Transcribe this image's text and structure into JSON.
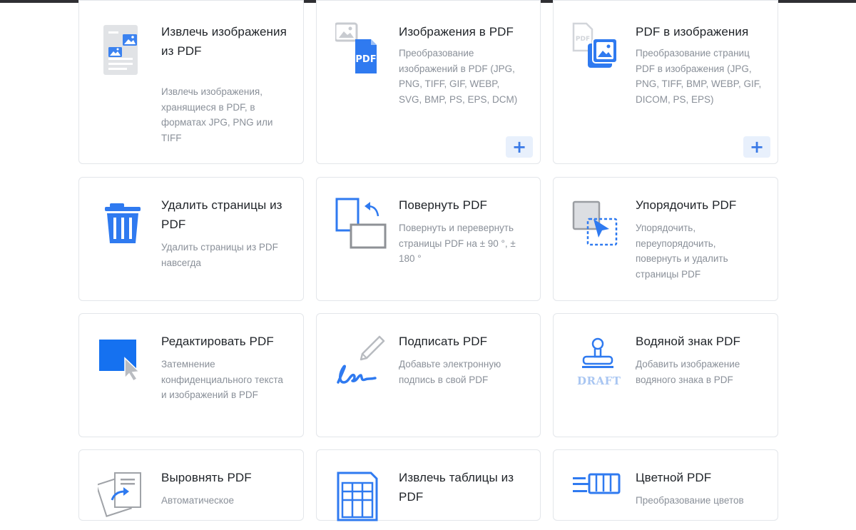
{
  "accent_color": "#2f7af0",
  "cards": [
    {
      "title": "Извлечь изображения из PDF",
      "desc": "Извлечь изображения, хранящиеся в PDF, в форматах JPG, PNG или TIFF",
      "icon": "extract-images-icon"
    },
    {
      "title": "Изображения в PDF",
      "desc": "Преобразование изображений в PDF (JPG, PNG, TIFF, GIF, WEBP, SVG, BMP, PS, EPS, DCM)",
      "icon": "image-to-pdf-icon",
      "plus": "+"
    },
    {
      "title": "PDF в изображения",
      "desc": "Преобразование страниц PDF в изображения (JPG, PNG, TIFF, BMP, WEBP, GIF, DICOM, PS, EPS)",
      "icon": "pdf-to-image-icon",
      "plus": "+"
    },
    {
      "title": "Удалить страницы из PDF",
      "desc": "Удалить страницы из PDF навсегда",
      "icon": "trash-icon"
    },
    {
      "title": "Повернуть PDF",
      "desc": "Повернуть и перевернуть страницы PDF на ± 90 °, ± 180 °",
      "icon": "rotate-icon"
    },
    {
      "title": "Упорядочить PDF",
      "desc": "Упорядочить, переупорядочить, повернуть и удалить страницы PDF",
      "icon": "organize-icon"
    },
    {
      "title": "Редактировать PDF",
      "desc": "Затемнение конфиденциального текста и изображений в PDF",
      "icon": "redact-icon"
    },
    {
      "title": "Подписать PDF",
      "desc": "Добавьте электронную подпись в свой PDF",
      "icon": "sign-pen-icon"
    },
    {
      "title": "Водяной знак PDF",
      "desc": "Добавить изображение водяного знака в PDF",
      "icon": "stamp-icon",
      "stamp_text": "DRAFT"
    },
    {
      "title": "Выровнять PDF",
      "desc": "Автоматическое",
      "icon": "deskew-icon"
    },
    {
      "title": "Извлечь таблицы из PDF",
      "desc": "",
      "icon": "table-icon"
    },
    {
      "title": "Цветной PDF",
      "desc": "Преобразование цветов",
      "icon": "color-brush-icon"
    }
  ]
}
